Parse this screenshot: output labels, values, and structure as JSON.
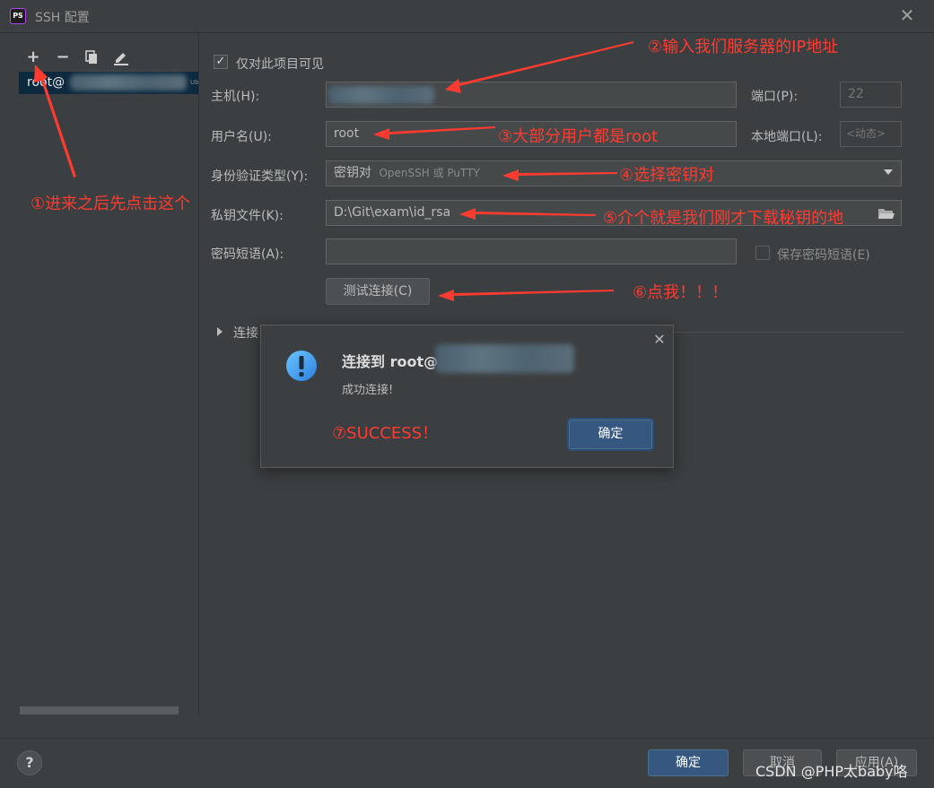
{
  "window": {
    "title": "SSH 配置",
    "app_icon_text": "PS"
  },
  "toolbar": {
    "add": "+",
    "remove": "−"
  },
  "host_list": {
    "items": [
      {
        "label": "root@"
      }
    ],
    "item_suffix": "Ub"
  },
  "form": {
    "visible_only_label": "仅对此项目可见",
    "host_label": "主机(H):",
    "port_label": "端口(P):",
    "port_value": "22",
    "username_label": "用户名(U):",
    "username_value": "root",
    "local_port_label": "本地端口(L):",
    "local_port_value": "<动态>",
    "auth_type_label": "身份验证类型(Y):",
    "auth_type_value": "密钥对",
    "auth_type_sub": "OpenSSH 或 PuTTY",
    "private_key_label": "私钥文件(K):",
    "private_key_value": "D:\\Git\\exam\\id_rsa",
    "passphrase_label": "密码短语(A):",
    "passphrase_value": "",
    "save_passphrase_label": "保存密码短语(E)",
    "test_button": "测试连接(C)",
    "connection_section": "连接"
  },
  "dialog": {
    "title": "连接到 root@",
    "message": "成功连接!",
    "ok": "确定"
  },
  "annotations": {
    "a1": "①进来之后先点击这个",
    "a2": "②输入我们服务器的IP地址",
    "a3": "③大部分用户都是root",
    "a4": "④选择密钥对",
    "a5": "⑤介个就是我们刚才下载秘钥的地",
    "a6": "⑥点我！！！",
    "a7": "⑦SUCCESS！"
  },
  "footer": {
    "ok": "确定",
    "cancel": "取消",
    "apply": "应用(A)"
  },
  "watermark": "CSDN @PHP太baby咯",
  "colors": {
    "annotation": "#ff3b30",
    "primary_button": "#365880",
    "selection": "#0d293e"
  }
}
